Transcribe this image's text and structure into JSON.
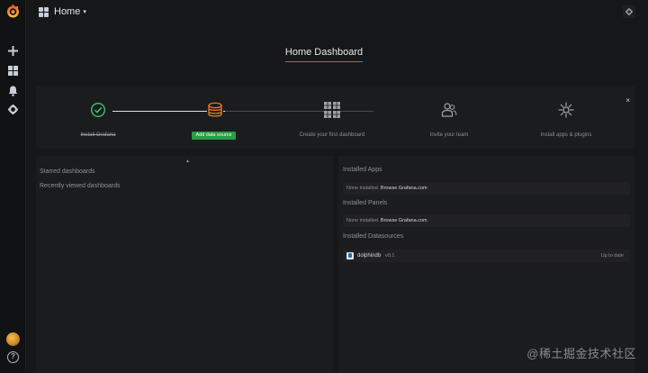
{
  "topbar": {
    "title": "Home",
    "caret": "▾"
  },
  "page": {
    "heading": "Home Dashboard"
  },
  "progress": {
    "steps": [
      {
        "label": "Install Grafana",
        "icon": "check-circle-icon",
        "done": true
      },
      {
        "label": "Add data source",
        "icon": "database-icon",
        "is_button": true
      },
      {
        "label": "Create your first dashboard",
        "icon": "dashboard-grid-icon"
      },
      {
        "label": "Invite your team",
        "icon": "users-icon"
      },
      {
        "label": "Install apps & plugins",
        "icon": "plugins-icon"
      }
    ],
    "close": "×"
  },
  "left_panel": {
    "handle": "▲",
    "starred": "Starred dashboards",
    "recent": "Recently viewed dashboards"
  },
  "right_panel": {
    "installed_apps_title": "Installed Apps",
    "installed_apps_none": "None installed.",
    "installed_apps_link": "Browse Grafana.com",
    "installed_panels_title": "Installed Panels",
    "installed_panels_none": "None installed.",
    "installed_panels_link": "Browse Grafana.com",
    "installed_datasources_title": "Installed Datasources",
    "datasource": {
      "name": "dolphindb",
      "version": "v0.1",
      "status": "Up to date"
    }
  },
  "watermark": "@稀土掘金技术社区",
  "colors": {
    "background": "#161719",
    "panel": "#1b1c1e",
    "accent_orange": "#eb7b18",
    "success_green": "#299c46",
    "check_green": "#3bd06c"
  }
}
